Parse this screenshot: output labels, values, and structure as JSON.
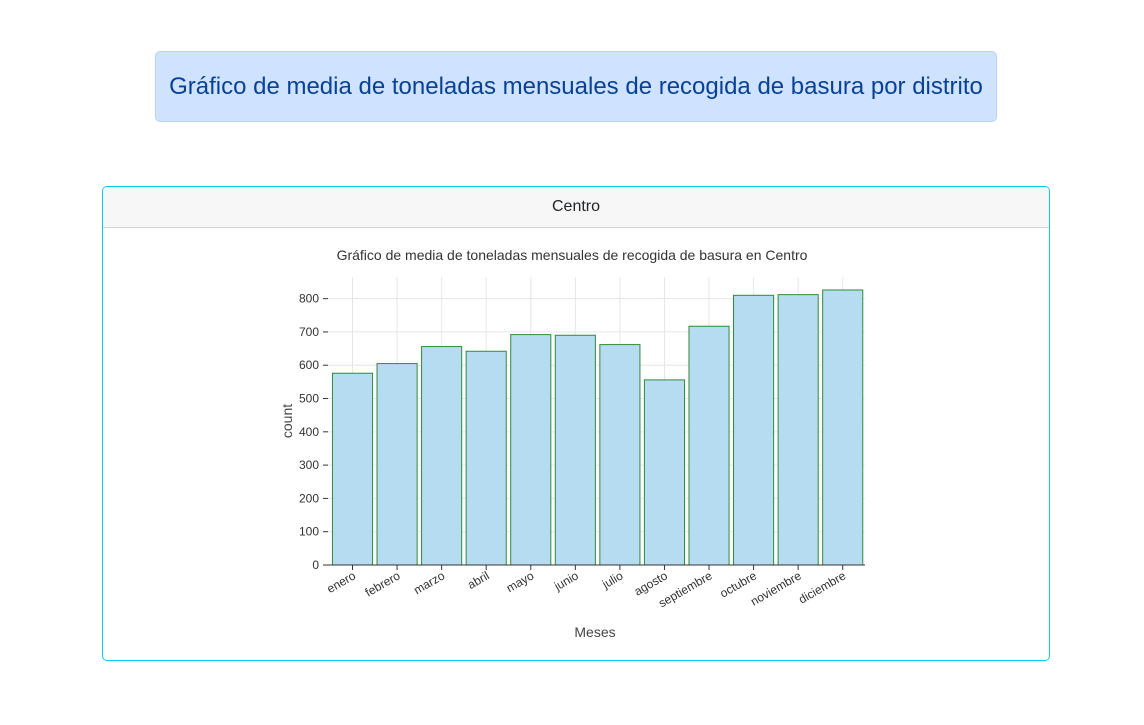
{
  "banner": {
    "title": "Gráfico de media de toneladas mensuales de recogida de basura por distrito"
  },
  "card": {
    "header": "Centro"
  },
  "colors": {
    "bar_fill": "#b6dcf1",
    "bar_stroke": "#2e8b3a",
    "grid": "#e6e6e6",
    "axis": "#333333"
  },
  "chart_data": {
    "type": "bar",
    "title": "Gráfico de media de toneladas mensuales de recogida de basura en Centro",
    "xlabel": "Meses",
    "ylabel": "count",
    "categories": [
      "enero",
      "febrero",
      "marzo",
      "abril",
      "mayo",
      "junio",
      "julio",
      "agosto",
      "septiembre",
      "octubre",
      "noviembre",
      "diciembre"
    ],
    "values": [
      576,
      605,
      656,
      642,
      692,
      690,
      662,
      556,
      717,
      810,
      812,
      826
    ],
    "ylim": [
      0,
      865
    ],
    "yticks": [
      0,
      100,
      200,
      300,
      400,
      500,
      600,
      700,
      800
    ],
    "grid": true,
    "legend": "none"
  }
}
